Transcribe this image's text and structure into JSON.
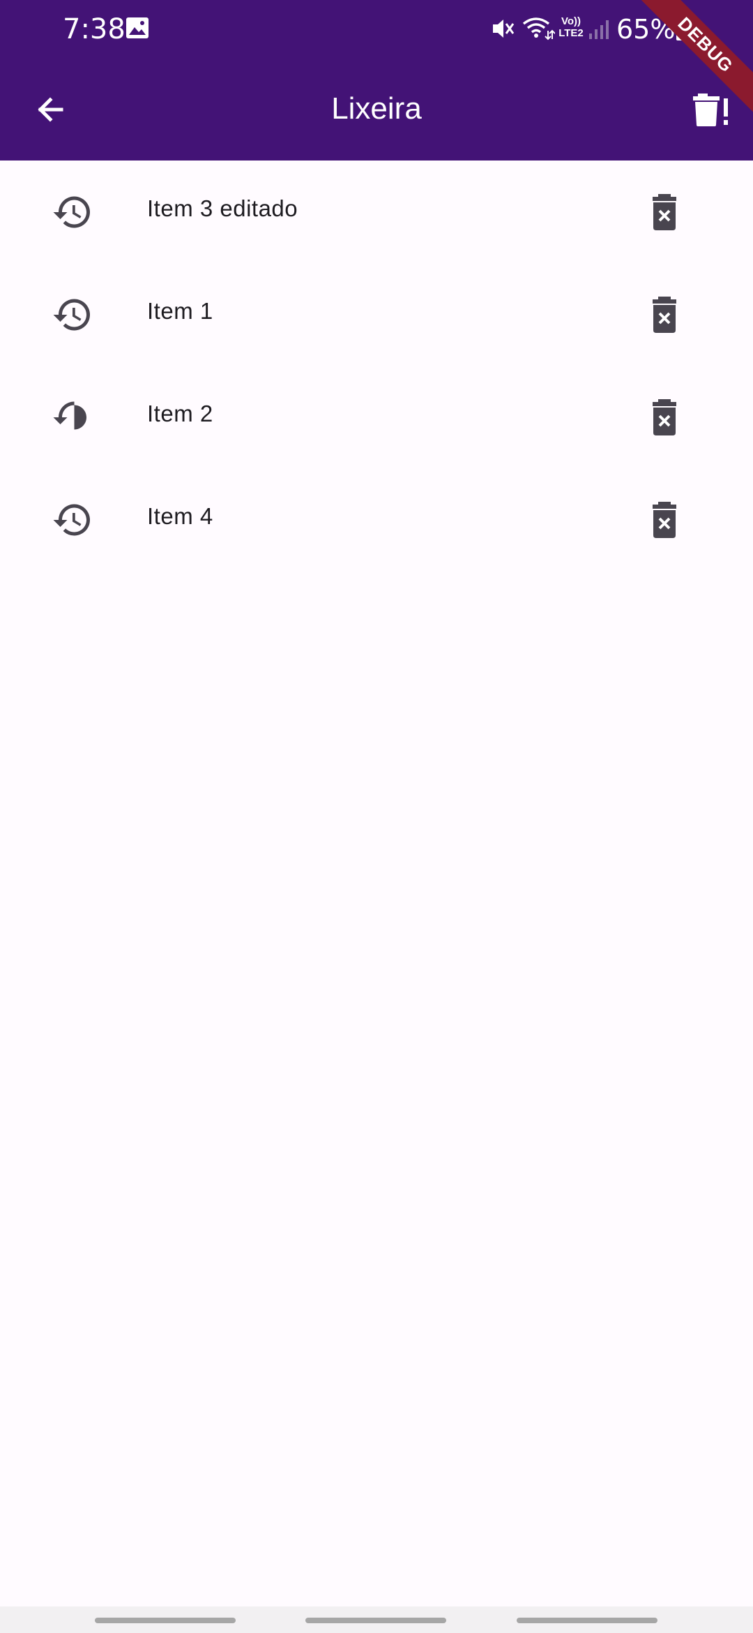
{
  "status_bar": {
    "time": "7:38",
    "network": "Vo))\nLTE2",
    "volte_top": "Vo))",
    "volte_bottom": "LTE2",
    "battery": "65%",
    "icons": [
      "gallery-icon",
      "mute-icon",
      "wifi-icon",
      "volte-icon",
      "signal-icon",
      "battery-icon"
    ]
  },
  "app_bar": {
    "title": "Lixeira",
    "back_icon": "arrow-back-icon",
    "action_icon": "delete-forever-icon",
    "background_color": "#431376"
  },
  "debug_banner": "DEBUG",
  "trash_items": [
    {
      "label": "Item 3 editado",
      "restore_icon": "history-icon",
      "delete_icon": "delete-x-icon"
    },
    {
      "label": "Item 1",
      "restore_icon": "history-icon",
      "delete_icon": "delete-x-icon"
    },
    {
      "label": "Item 2",
      "restore_icon": "history-icon",
      "delete_icon": "delete-x-icon"
    },
    {
      "label": "Item 4",
      "restore_icon": "history-icon",
      "delete_icon": "delete-x-icon"
    }
  ],
  "colors": {
    "primary": "#431376",
    "background": "#fffbff",
    "icon": "#49454f",
    "text": "#1d1b20",
    "debug": "#8b1a2e"
  }
}
